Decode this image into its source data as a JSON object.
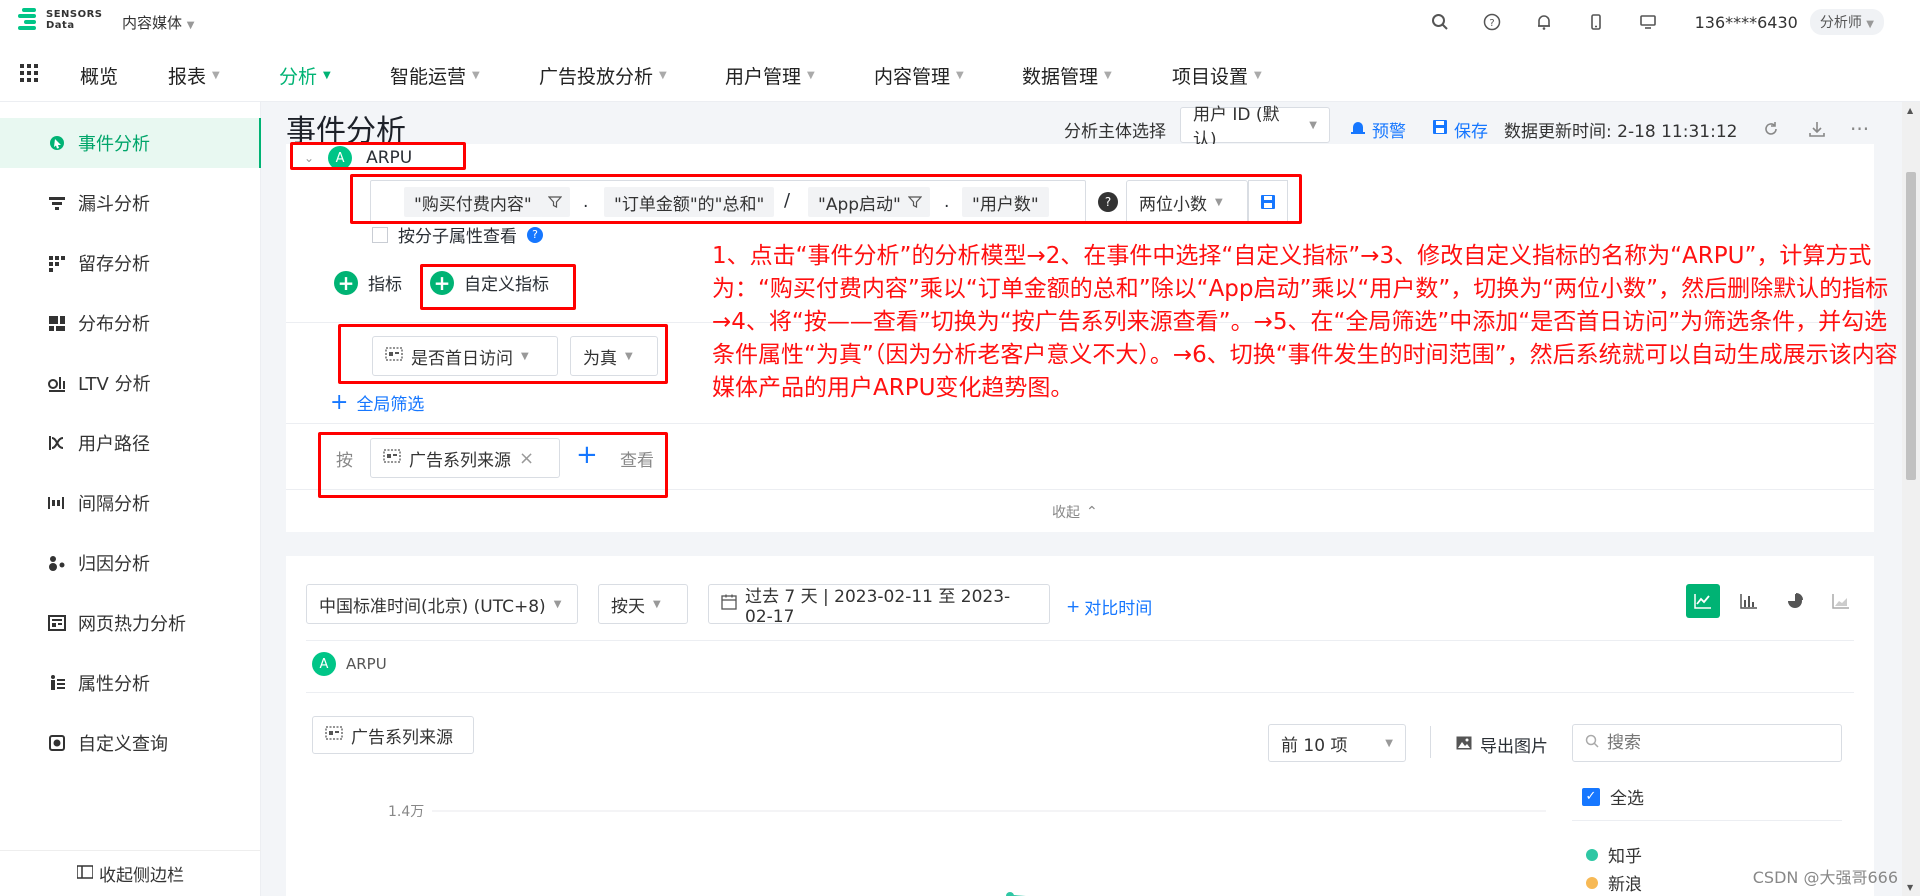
{
  "brand": {
    "line1": "SENSORS",
    "line2": "Data",
    "accent": "#00b374"
  },
  "project_selector": {
    "label": "内容媒体"
  },
  "top_icons": [
    "search-icon",
    "help-icon",
    "bell-icon",
    "mobile-icon",
    "monitor-icon"
  ],
  "user": {
    "phone": "136****6430",
    "role": "分析师"
  },
  "nav": {
    "items": [
      {
        "label": "概览",
        "has_caret": false,
        "active": false
      },
      {
        "label": "报表",
        "has_caret": true,
        "active": false
      },
      {
        "label": "分析",
        "has_caret": true,
        "active": true
      },
      {
        "label": "智能运营",
        "has_caret": true,
        "active": false
      },
      {
        "label": "广告投放分析",
        "has_caret": true,
        "active": false
      },
      {
        "label": "用户管理",
        "has_caret": true,
        "active": false
      },
      {
        "label": "内容管理",
        "has_caret": true,
        "active": false
      },
      {
        "label": "数据管理",
        "has_caret": true,
        "active": false
      },
      {
        "label": "项目设置",
        "has_caret": true,
        "active": false
      }
    ]
  },
  "sidebar": {
    "items": [
      {
        "label": "事件分析",
        "icon": "event-analysis-icon",
        "active": true
      },
      {
        "label": "漏斗分析",
        "icon": "funnel-icon",
        "active": false
      },
      {
        "label": "留存分析",
        "icon": "retention-icon",
        "active": false
      },
      {
        "label": "分布分析",
        "icon": "distribution-icon",
        "active": false
      },
      {
        "label": "LTV 分析",
        "icon": "ltv-icon",
        "active": false
      },
      {
        "label": "用户路径",
        "icon": "user-path-icon",
        "active": false
      },
      {
        "label": "间隔分析",
        "icon": "interval-icon",
        "active": false
      },
      {
        "label": "归因分析",
        "icon": "attribution-icon",
        "active": false
      },
      {
        "label": "网页热力分析",
        "icon": "heatmap-icon",
        "active": false
      },
      {
        "label": "属性分析",
        "icon": "property-icon",
        "active": false
      },
      {
        "label": "自定义查询",
        "icon": "custom-query-icon",
        "active": false
      }
    ],
    "collapse_label": "收起侧边栏"
  },
  "header": {
    "title": "事件分析",
    "subject_label": "分析主体选择",
    "subject_value": "用户 ID (默认)",
    "alert_label": "预警",
    "save_label": "保存",
    "update_time": "数据更新时间: 2-18 11:31:12"
  },
  "metric": {
    "badge": "A",
    "name": "ARPU",
    "formula": [
      {
        "kind": "chip",
        "text": "\"购买付费内容\"",
        "filter": true
      },
      {
        "kind": "op",
        "text": "."
      },
      {
        "kind": "chip",
        "text": "\"订单金额\"的\"总和\"",
        "filter": false
      },
      {
        "kind": "op",
        "text": "/"
      },
      {
        "kind": "chip",
        "text": "\"App启动\"",
        "filter": true
      },
      {
        "kind": "op",
        "text": "."
      },
      {
        "kind": "chip",
        "text": "\"用户数\"",
        "filter": false
      }
    ],
    "precision": "两位小数",
    "sub_property_label": "按分子属性查看",
    "add_metric_label": "指标",
    "add_custom_label": "自定义指标"
  },
  "filter": {
    "field": "是否首日访问",
    "value": "为真",
    "add_global_label": "全局筛选"
  },
  "groupby": {
    "prefix": "按",
    "field": "广告系列来源",
    "suffix": "查看"
  },
  "collapse_label": "收起",
  "annotation": "1、点击“事件分析”的分析模型→2、在事件中选择“自定义指标”→3、修改自定义指标的名称为“ARPU”，计算方式为：“购买付费内容”乘以“订单金额的总和”除以“App启动”乘以“用户数”，切换为“两位小数”，然后删除默认的指标→4、将“按——查看”切换为“按广告系列来源查看”。→5、在“全局筛选”中添加“是否首日访问”为筛选条件，并勾选条件属性“为真”（因为分析老客户意义不大）。→6、切换“事件发生的时间范围”，然后系统就可以自动生成展示该内容媒体产品的用户ARPU变化趋势图。",
  "chart_panel": {
    "timezone": "中国标准时间(北京) (UTC+8)",
    "granularity": "按天",
    "date_range": "过去 7 天 | 2023-02-11 至 2023-02-17",
    "compare_label": "对比时间",
    "chart_types": [
      "line-chart-icon",
      "bar-chart-icon",
      "pie-chart-icon",
      "area-chart-icon"
    ],
    "metric_badge": "A",
    "metric_name": "ARPU",
    "group_chip": "广告系列来源",
    "topn": "前 10 项",
    "export_label": "导出图片",
    "search_placeholder": "搜索",
    "select_all": "全选",
    "legend": [
      {
        "name": "知乎",
        "color": "#2ec7a4"
      },
      {
        "name": "新浪",
        "color": "#f7b955"
      }
    ],
    "y_tick": "1.4万"
  },
  "chart_data": {
    "type": "line",
    "ylabel": "",
    "y_ticks": [
      "1.4万"
    ],
    "series": [
      {
        "name": "知乎",
        "values": []
      },
      {
        "name": "新浪",
        "values": []
      }
    ]
  },
  "watermark": "CSDN @大强哥666"
}
